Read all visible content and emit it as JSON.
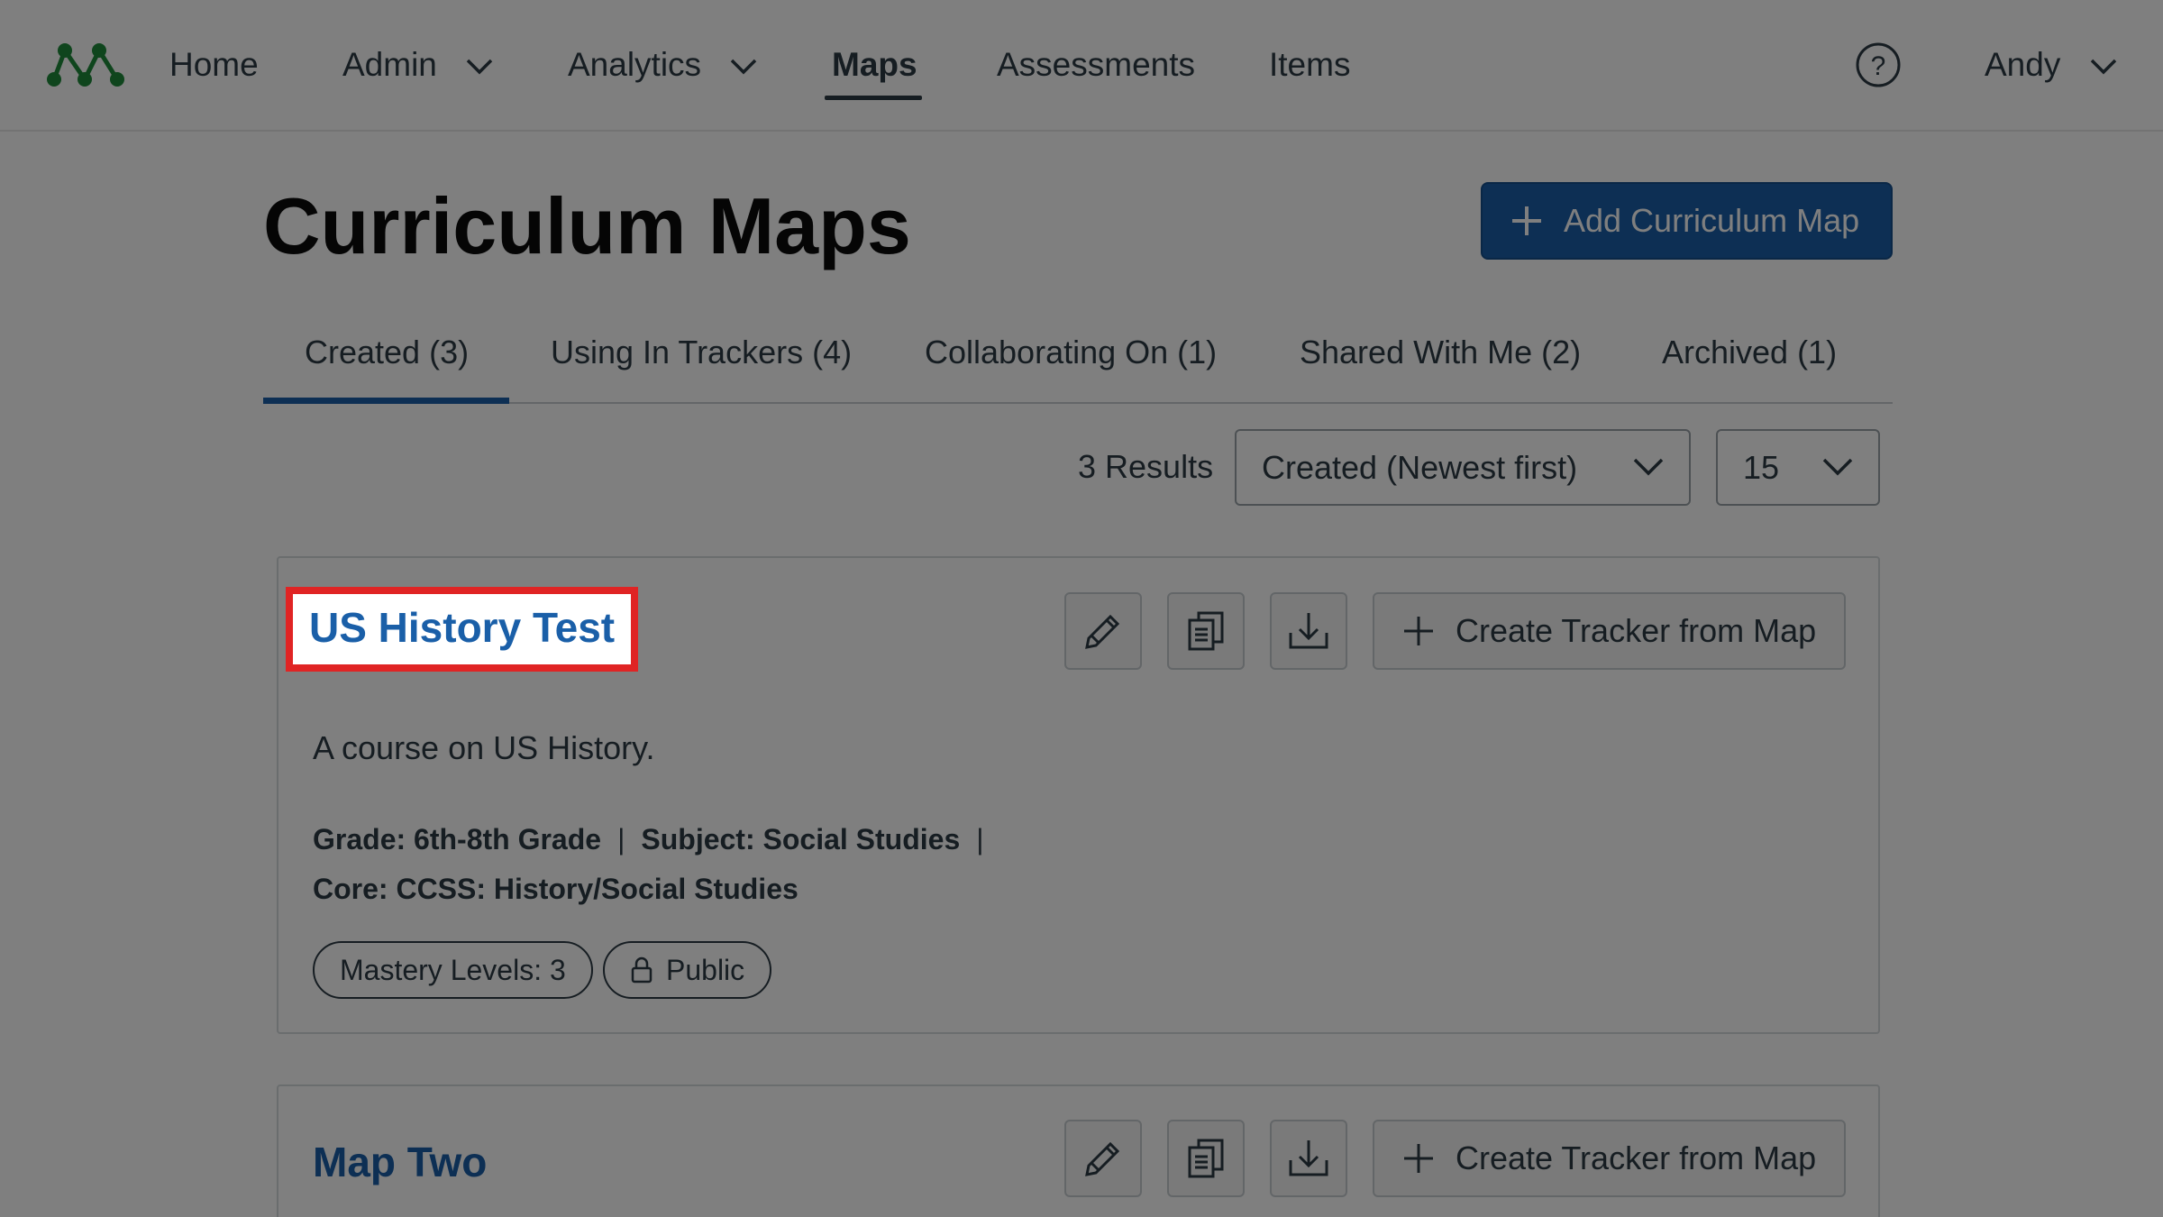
{
  "nav": {
    "items": [
      {
        "label": "Home"
      },
      {
        "label": "Admin"
      },
      {
        "label": "Analytics"
      },
      {
        "label": "Maps"
      },
      {
        "label": "Assessments"
      },
      {
        "label": "Items"
      }
    ],
    "user": "Andy",
    "logo_color": "#1f8a3a"
  },
  "page": {
    "title": "Curriculum Maps",
    "add_button_label": "Add Curriculum Map"
  },
  "tabs": [
    {
      "label": "Created (3)"
    },
    {
      "label": "Using In Trackers (4)"
    },
    {
      "label": "Collaborating On (1)"
    },
    {
      "label": "Shared With Me (2)"
    },
    {
      "label": "Archived (1)"
    }
  ],
  "results": {
    "count_label": "3 Results",
    "sort_value": "Created (Newest first)",
    "per_page_value": "15"
  },
  "maps": [
    {
      "title": "US History Test",
      "description": "A course on US History.",
      "grade": "Grade: 6th-8th Grade",
      "subject": "Subject: Social Studies",
      "separator": "|",
      "core": "Core: CCSS: History/Social Studies",
      "mastery": "Mastery Levels: 3",
      "visibility": "Public",
      "tracker_label": "Create Tracker from Map"
    },
    {
      "title": "Map Two",
      "tracker_label": "Create Tracker from Map"
    }
  ],
  "colors": {
    "accent": "#1a5fa8",
    "highlight": "#e02424"
  }
}
